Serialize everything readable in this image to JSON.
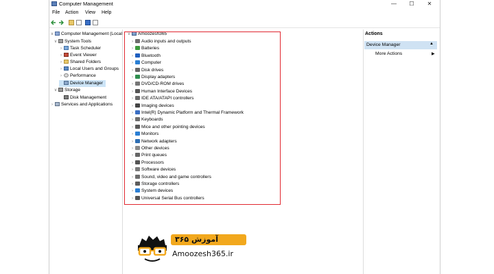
{
  "window": {
    "title": "Computer Management"
  },
  "menu": [
    "File",
    "Action",
    "View",
    "Help"
  ],
  "tree": {
    "root": "Computer Management (Local",
    "system_tools": "System Tools",
    "children": [
      "Task Scheduler",
      "Event Viewer",
      "Shared Folders",
      "Local Users and Groups",
      "Performance",
      "Device Manager"
    ],
    "storage": "Storage",
    "disk_management": "Disk Management",
    "services": "Services and Applications"
  },
  "devices": {
    "computer_name": "Amoozesh365",
    "items": [
      {
        "label": "Audio inputs and outputs",
        "icon": "speaker-icon",
        "color": "#6d6d6d"
      },
      {
        "label": "Batteries",
        "icon": "battery-icon",
        "color": "#3c9a3c"
      },
      {
        "label": "Bluetooth",
        "icon": "bluetooth-icon",
        "color": "#1f5fbf"
      },
      {
        "label": "Computer",
        "icon": "monitor-icon",
        "color": "#2a7fd4"
      },
      {
        "label": "Disk drives",
        "icon": "disk-icon",
        "color": "#666666"
      },
      {
        "label": "Display adapters",
        "icon": "display-adapter-icon",
        "color": "#2f8f4f"
      },
      {
        "label": "DVD/CD-ROM drives",
        "icon": "dvd-icon",
        "color": "#777777"
      },
      {
        "label": "Human Interface Devices",
        "icon": "hid-icon",
        "color": "#555555"
      },
      {
        "label": "IDE ATA/ATAPI controllers",
        "icon": "ide-icon",
        "color": "#6a6a6a"
      },
      {
        "label": "Imaging devices",
        "icon": "camera-icon",
        "color": "#444444"
      },
      {
        "label": "Intel(R) Dynamic Platform and Thermal Framework",
        "icon": "chip-icon",
        "color": "#3b6fc4"
      },
      {
        "label": "Keyboards",
        "icon": "keyboard-icon",
        "color": "#6e6e6e"
      },
      {
        "label": "Mice and other pointing devices",
        "icon": "mouse-icon",
        "color": "#5a5a5a"
      },
      {
        "label": "Monitors",
        "icon": "monitor-icon",
        "color": "#2a7fd4"
      },
      {
        "label": "Network adapters",
        "icon": "network-icon",
        "color": "#2f6fb4"
      },
      {
        "label": "Other devices",
        "icon": "other-devices-icon",
        "color": "#8a8a8a"
      },
      {
        "label": "Print queues",
        "icon": "printer-icon",
        "color": "#666666"
      },
      {
        "label": "Processors",
        "icon": "processor-icon",
        "color": "#555555"
      },
      {
        "label": "Software devices",
        "icon": "software-device-icon",
        "color": "#7a7a7a"
      },
      {
        "label": "Sound, video and game controllers",
        "icon": "speaker-icon",
        "color": "#6d6d6d"
      },
      {
        "label": "Storage controllers",
        "icon": "storage-controller-icon",
        "color": "#5d5d5d"
      },
      {
        "label": "System devices",
        "icon": "system-device-icon",
        "color": "#2a7fd4"
      },
      {
        "label": "Universal Serial Bus controllers",
        "icon": "usb-icon",
        "color": "#555555"
      }
    ]
  },
  "actions": {
    "header": "Actions",
    "section": "Device Manager",
    "item": "More Actions"
  },
  "watermark": {
    "brand_fa": "آموزش ۳۶۵",
    "url": "Amoozesh365.ir",
    "accent": "#f2a81d"
  }
}
